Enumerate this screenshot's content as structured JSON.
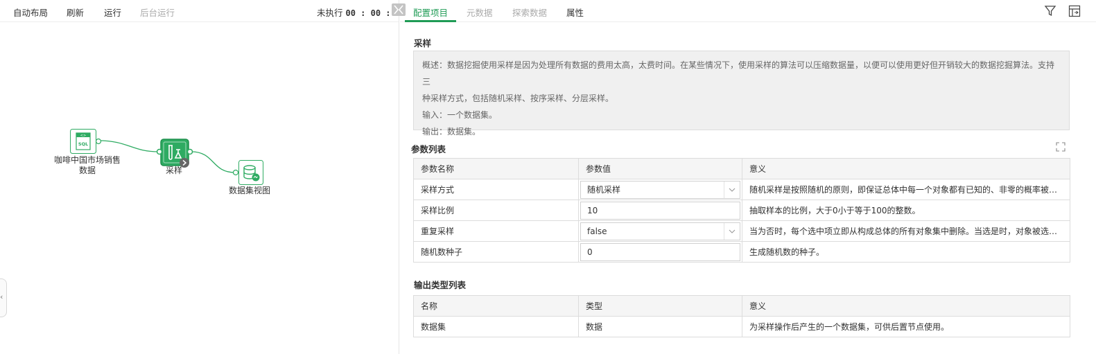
{
  "toolbar": {
    "auto_layout": "自动布局",
    "refresh": "刷新",
    "run": "运行",
    "background_run": "后台运行",
    "status_label": "未执行",
    "status_time": "00 : 00 : 00"
  },
  "canvas": {
    "nodes": {
      "source": {
        "label_line1": "咖啡中国市场销售",
        "label_line2": "数据",
        "badge": "SQL"
      },
      "sample": {
        "label": "采样"
      },
      "dataset_view": {
        "label": "数据集视图"
      }
    }
  },
  "tabs": [
    {
      "label": "配置项目",
      "state": "active"
    },
    {
      "label": "元数据",
      "state": "disabled"
    },
    {
      "label": "探索数据",
      "state": "disabled"
    },
    {
      "label": "属性",
      "state": "normal"
    }
  ],
  "sampling": {
    "title": "采样",
    "description": [
      "概述：数据挖掘使用采样是因为处理所有数据的费用太高，太费时间。在某些情况下，使用采样的算法可以压缩数据量，以便可以使用更好但开销较大的数据挖掘算法。支持三",
      "种采样方式，包括随机采样、按序采样、分层采样。",
      "输入：一个数据集。",
      "输出：数据集。"
    ]
  },
  "params": {
    "title": "参数列表",
    "headers": [
      "参数名称",
      "参数值",
      "意义"
    ],
    "rows": [
      {
        "name": "采样方式",
        "value": "随机采样",
        "kind": "select",
        "meaning": "随机采样是按照随机的原则，即保证总体中每一个对象都有已知的、非零的概率被选入..."
      },
      {
        "name": "采样比例",
        "value": "10",
        "kind": "input",
        "meaning": "抽取样本的比例，大于0小于等于100的整数。"
      },
      {
        "name": "重复采样",
        "value": "false",
        "kind": "select",
        "meaning": "当为否时，每个选中项立即从构成总体的所有对象集中删除。当选是时，对象被选中时..."
      },
      {
        "name": "随机数种子",
        "value": "0",
        "kind": "input",
        "meaning": "生成随机数的种子。"
      }
    ]
  },
  "outputs": {
    "title": "输出类型列表",
    "headers": [
      "名称",
      "类型",
      "意义"
    ],
    "rows": [
      {
        "name": "数据集",
        "type": "数据",
        "meaning": "为采样操作后产生的一个数据集，可供后置节点使用。"
      }
    ]
  },
  "colors": {
    "accent": "#1f9b55",
    "node_fill": "#2eab62",
    "disabled_text": "#aaaaaa"
  },
  "icons": {
    "filter": "filter-icon",
    "layout": "layout-toggle-icon",
    "expand": "expand-icon",
    "collapse": "collapse-panel-icon"
  }
}
